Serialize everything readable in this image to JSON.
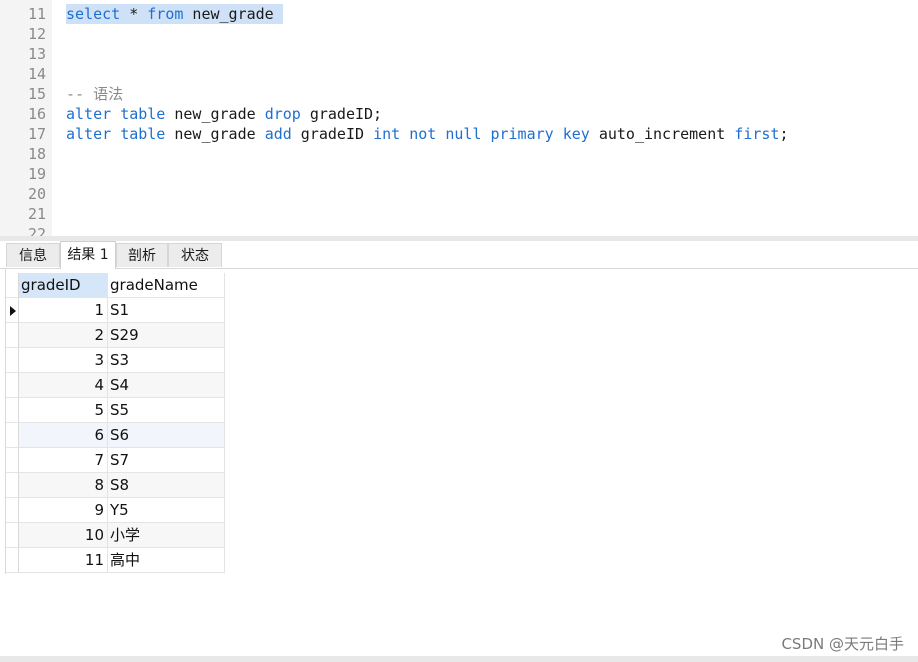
{
  "editor": {
    "lines": [
      {
        "num": "11",
        "tokens": [
          {
            "t": "select",
            "k": "kw"
          },
          {
            "t": " * ",
            "k": ""
          },
          {
            "t": "from",
            "k": "kw"
          },
          {
            "t": " new_grade ",
            "k": ""
          }
        ],
        "selected": true
      },
      {
        "num": "12",
        "tokens": []
      },
      {
        "num": "13",
        "tokens": []
      },
      {
        "num": "14",
        "tokens": []
      },
      {
        "num": "15",
        "tokens": [
          {
            "t": "-- 语法",
            "k": "cm"
          }
        ]
      },
      {
        "num": "16",
        "tokens": [
          {
            "t": "alter",
            "k": "kw"
          },
          {
            "t": " ",
            "k": ""
          },
          {
            "t": "table",
            "k": "kw"
          },
          {
            "t": " new_grade ",
            "k": ""
          },
          {
            "t": "drop",
            "k": "kw"
          },
          {
            "t": " gradeID;",
            "k": ""
          }
        ]
      },
      {
        "num": "17",
        "tokens": [
          {
            "t": "alter",
            "k": "kw"
          },
          {
            "t": " ",
            "k": ""
          },
          {
            "t": "table",
            "k": "kw"
          },
          {
            "t": " new_grade ",
            "k": ""
          },
          {
            "t": "add",
            "k": "kw"
          },
          {
            "t": " gradeID ",
            "k": ""
          },
          {
            "t": "int",
            "k": "kw"
          },
          {
            "t": " ",
            "k": ""
          },
          {
            "t": "not",
            "k": "kw"
          },
          {
            "t": " ",
            "k": ""
          },
          {
            "t": "null",
            "k": "kw"
          },
          {
            "t": " ",
            "k": ""
          },
          {
            "t": "primary",
            "k": "kw"
          },
          {
            "t": " ",
            "k": ""
          },
          {
            "t": "key",
            "k": "kw"
          },
          {
            "t": " auto_increment ",
            "k": ""
          },
          {
            "t": "first",
            "k": "kw"
          },
          {
            "t": ";",
            "k": ""
          }
        ]
      },
      {
        "num": "18",
        "tokens": []
      },
      {
        "num": "19",
        "tokens": []
      },
      {
        "num": "20",
        "tokens": []
      },
      {
        "num": "21",
        "tokens": []
      },
      {
        "num": "22",
        "tokens": []
      }
    ]
  },
  "tabs": {
    "info": "信息",
    "result1": "结果 1",
    "profile": "剖析",
    "status": "状态"
  },
  "grid": {
    "columns": [
      "gradeID",
      "gradeName"
    ],
    "rows": [
      [
        "1",
        "S1"
      ],
      [
        "2",
        "S29"
      ],
      [
        "3",
        "S3"
      ],
      [
        "4",
        "S4"
      ],
      [
        "5",
        "S5"
      ],
      [
        "6",
        "S6"
      ],
      [
        "7",
        "S7"
      ],
      [
        "8",
        "S8"
      ],
      [
        "9",
        "Y5"
      ],
      [
        "10",
        "小学"
      ],
      [
        "11",
        "高中"
      ]
    ]
  },
  "watermark": "CSDN @天元白手",
  "colors": {
    "keyword": "#1f6fd0",
    "comment": "#8a8a8a",
    "selection": "#cfe1f7"
  }
}
